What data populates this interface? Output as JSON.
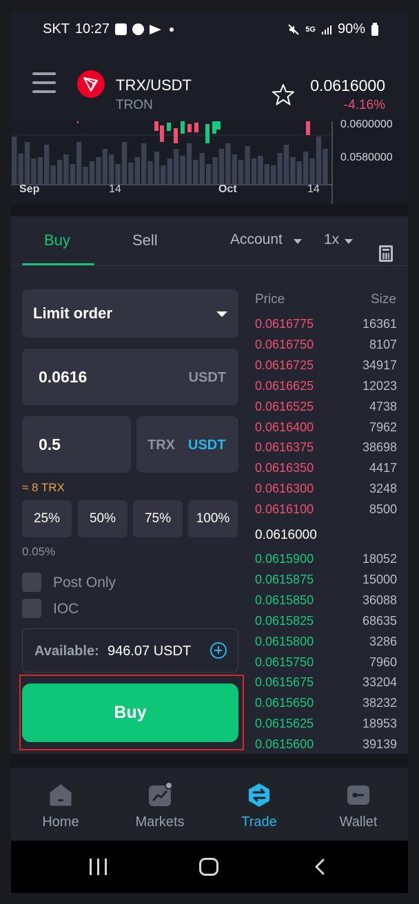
{
  "status_bar": {
    "carrier": "SKT",
    "time": "10:27",
    "network": "5G",
    "battery": "90%"
  },
  "header": {
    "pair": "TRX/USDT",
    "name": "TRON",
    "price": "0.0616000",
    "change": "-4.16%",
    "change_color": "#f0506e"
  },
  "chart": {
    "price_ticks": [
      "0.0600000",
      "0.0580000"
    ],
    "date_labels": [
      "Sep",
      "14",
      "Oct",
      "14"
    ],
    "up_color": "#19c77e",
    "down_color": "#f0506e"
  },
  "trade_tabs": {
    "buy": "Buy",
    "sell": "Sell",
    "account": "Account",
    "leverage": "1x"
  },
  "order_form": {
    "order_type": "Limit order",
    "price_value": "0.0616",
    "price_unit": "USDT",
    "quantity_value": "0.5",
    "unit_trx": "TRX",
    "unit_usdt": "USDT",
    "approx": "≈ 8 TRX",
    "percent_buttons": [
      "25%",
      "50%",
      "75%",
      "100%"
    ],
    "fee": "0.05%",
    "post_only": "Post Only",
    "ioc": "IOC",
    "available_label": "Available:",
    "available_value": "946.07 USDT",
    "buy_button": "Buy",
    "accent": "#0dc678"
  },
  "order_book": {
    "price_header": "Price",
    "size_header": "Size",
    "asks": [
      {
        "price": "0.0616775",
        "size": "16361"
      },
      {
        "price": "0.0616750",
        "size": "8107"
      },
      {
        "price": "0.0616725",
        "size": "34917"
      },
      {
        "price": "0.0616625",
        "size": "12023"
      },
      {
        "price": "0.0616525",
        "size": "4738"
      },
      {
        "price": "0.0616400",
        "size": "7962"
      },
      {
        "price": "0.0616375",
        "size": "38698"
      },
      {
        "price": "0.0616350",
        "size": "4417"
      },
      {
        "price": "0.0616300",
        "size": "3248"
      },
      {
        "price": "0.0616100",
        "size": "8500"
      }
    ],
    "mid_price": "0.0616000",
    "bids": [
      {
        "price": "0.0615900",
        "size": "18052"
      },
      {
        "price": "0.0615875",
        "size": "15000"
      },
      {
        "price": "0.0615850",
        "size": "36088"
      },
      {
        "price": "0.0615825",
        "size": "68635"
      },
      {
        "price": "0.0615800",
        "size": "3286"
      },
      {
        "price": "0.0615750",
        "size": "7960"
      },
      {
        "price": "0.0615675",
        "size": "33204"
      },
      {
        "price": "0.0615650",
        "size": "38232"
      },
      {
        "price": "0.0615625",
        "size": "18953"
      },
      {
        "price": "0.0615600",
        "size": "39139"
      }
    ]
  },
  "bottom_nav": {
    "items": [
      {
        "label": "Home",
        "icon": "home-icon"
      },
      {
        "label": "Markets",
        "icon": "markets-icon"
      },
      {
        "label": "Trade",
        "icon": "trade-icon"
      },
      {
        "label": "Wallet",
        "icon": "wallet-icon"
      }
    ],
    "active": "Trade",
    "active_color": "#29b6e8"
  }
}
